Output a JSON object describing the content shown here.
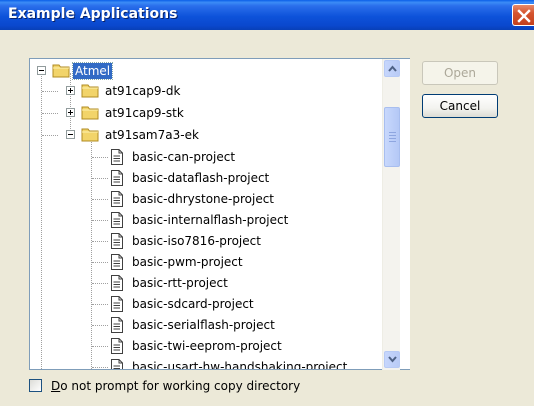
{
  "window": {
    "title": "Example Applications",
    "close_label": "Close"
  },
  "tree": {
    "root": {
      "label": "Atmel",
      "expanded": true,
      "selected": true
    },
    "groups": [
      {
        "label": "at91cap9-dk",
        "expanded": false
      },
      {
        "label": "at91cap9-stk",
        "expanded": false
      },
      {
        "label": "at91sam7a3-ek",
        "expanded": true
      }
    ],
    "projects": [
      "basic-can-project",
      "basic-dataflash-project",
      "basic-dhrystone-project",
      "basic-internalflash-project",
      "basic-iso7816-project",
      "basic-pwm-project",
      "basic-rtt-project",
      "basic-sdcard-project",
      "basic-serialflash-project",
      "basic-twi-eeprom-project",
      "basic-usart-hw-handshaking-project"
    ],
    "icons": {
      "folder": "folder-icon",
      "file": "document-icon",
      "expand": "plus-box-icon",
      "collapse": "minus-box-icon"
    }
  },
  "scrollbar": {
    "position_fraction": 0.12
  },
  "buttons": {
    "open": {
      "label": "Open",
      "enabled": false
    },
    "cancel": {
      "label": "Cancel",
      "enabled": true
    }
  },
  "options": {
    "no_prompt": {
      "label_mnemonic": "D",
      "label_rest": "o not prompt for working copy directory",
      "checked": false
    }
  },
  "colors": {
    "title_bar": "#0A48CE",
    "selection": "#316AC5",
    "dialog_bg": "#ECE9D8",
    "close_button": "#D5552F"
  }
}
